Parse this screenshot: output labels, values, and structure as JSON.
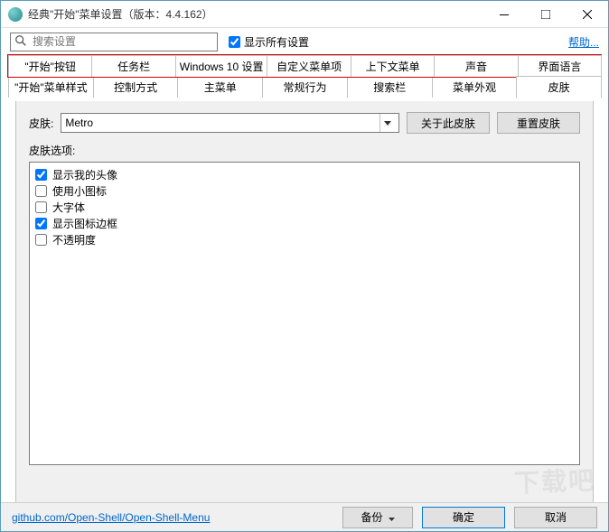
{
  "window": {
    "title": "经典\"开始\"菜单设置（版本：4.4.162）"
  },
  "search": {
    "placeholder": "搜索设置"
  },
  "show_all_label": "显示所有设置",
  "help_label": "帮助...",
  "tabs_row1": [
    {
      "label": "\"开始\"按钮"
    },
    {
      "label": "任务栏"
    },
    {
      "label": "Windows 10 设置"
    },
    {
      "label": "自定义菜单项"
    },
    {
      "label": "上下文菜单"
    },
    {
      "label": "声音"
    },
    {
      "label": "界面语言"
    }
  ],
  "tabs_row2": [
    {
      "label": "\"开始\"菜单样式"
    },
    {
      "label": "控制方式"
    },
    {
      "label": "主菜单"
    },
    {
      "label": "常规行为"
    },
    {
      "label": "搜索栏"
    },
    {
      "label": "菜单外观"
    },
    {
      "label": "皮肤",
      "active": true
    }
  ],
  "skin": {
    "label": "皮肤:",
    "value": "Metro",
    "about_btn": "关于此皮肤",
    "reset_btn": "重置皮肤",
    "options_label": "皮肤选项:",
    "options": [
      {
        "label": "显示我的头像",
        "checked": true
      },
      {
        "label": "使用小图标",
        "checked": false
      },
      {
        "label": "大字体",
        "checked": false
      },
      {
        "label": "显示图标边框",
        "checked": true
      },
      {
        "label": "不透明度",
        "checked": false
      }
    ]
  },
  "footer": {
    "link": "github.com/Open-Shell/Open-Shell-Menu",
    "backup_btn": "备份",
    "ok_btn": "确定",
    "cancel_btn": "取消"
  },
  "watermark": "下载吧"
}
